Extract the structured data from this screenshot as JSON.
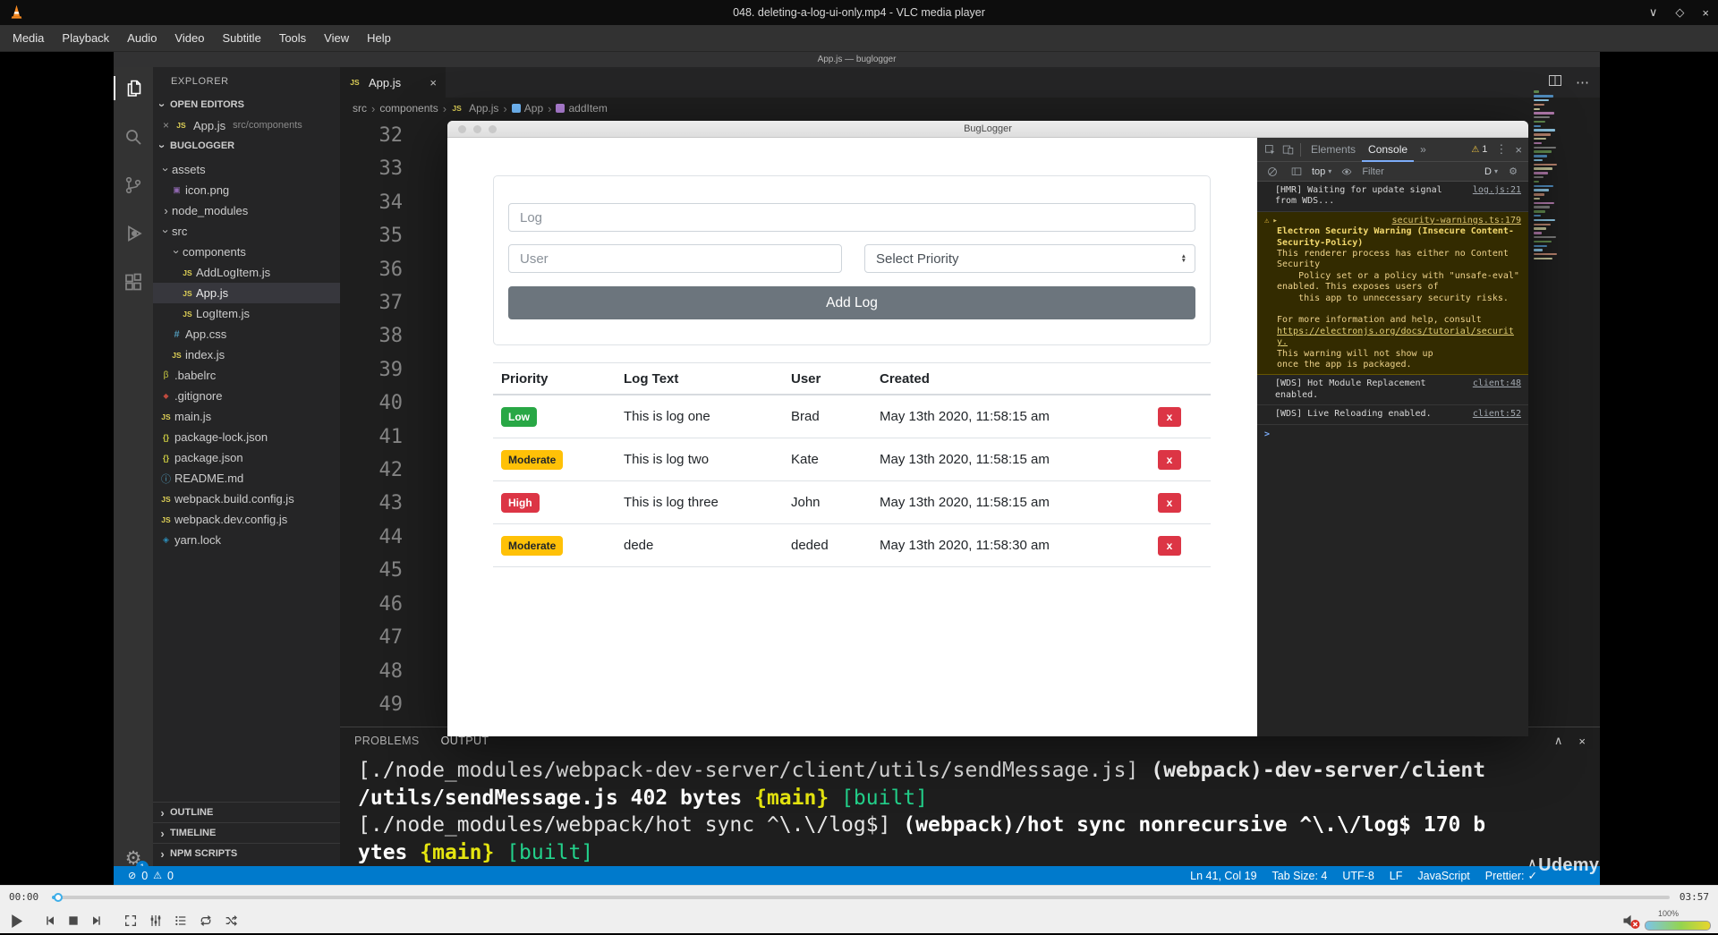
{
  "vlc": {
    "window_title": "048. deleting-a-log-ui-only.mp4 - VLC media player",
    "menu_items": [
      "Media",
      "Playback",
      "Audio",
      "Video",
      "Subtitle",
      "Tools",
      "View",
      "Help"
    ],
    "seek": {
      "elapsed": "00:00",
      "duration": "03:57"
    },
    "volume_label": "100%"
  },
  "vscode": {
    "window_title": "App.js — buglogger",
    "activity_bar": {
      "settings_badge": "1"
    },
    "explorer": {
      "title": "EXPLORER",
      "sections": {
        "open_editors": "OPEN EDITORS",
        "project": "BUGLOGGER"
      },
      "open_editor": {
        "file": "App.js",
        "path": "src/components"
      },
      "tree": [
        {
          "label": "assets",
          "icon": "folder",
          "chevron": "down",
          "level": 0
        },
        {
          "label": "icon.png",
          "icon": "image",
          "chevron": "none",
          "level": 1
        },
        {
          "label": "node_modules",
          "icon": "folder",
          "chevron": "right",
          "level": 0
        },
        {
          "label": "src",
          "icon": "folder",
          "chevron": "down",
          "level": 0
        },
        {
          "label": "components",
          "icon": "folder",
          "chevron": "down",
          "level": 1
        },
        {
          "label": "AddLogItem.js",
          "icon": "js",
          "chevron": "none",
          "level": 2
        },
        {
          "label": "App.js",
          "icon": "js",
          "chevron": "none",
          "level": 2,
          "selected": true
        },
        {
          "label": "LogItem.js",
          "icon": "js",
          "chevron": "none",
          "level": 2
        },
        {
          "label": "App.css",
          "icon": "css",
          "chevron": "none",
          "level": 1
        },
        {
          "label": "index.js",
          "icon": "js",
          "chevron": "none",
          "level": 1
        },
        {
          "label": ".babelrc",
          "icon": "babel",
          "chevron": "none",
          "level": 0
        },
        {
          "label": ".gitignore",
          "icon": "git",
          "chevron": "none",
          "level": 0
        },
        {
          "label": "main.js",
          "icon": "js",
          "chevron": "none",
          "level": 0
        },
        {
          "label": "package-lock.json",
          "icon": "json",
          "chevron": "none",
          "level": 0
        },
        {
          "label": "package.json",
          "icon": "json",
          "chevron": "none",
          "level": 0
        },
        {
          "label": "README.md",
          "icon": "info",
          "chevron": "none",
          "level": 0
        },
        {
          "label": "webpack.build.config.js",
          "icon": "js",
          "chevron": "none",
          "level": 0
        },
        {
          "label": "webpack.dev.config.js",
          "icon": "js",
          "chevron": "none",
          "level": 0
        },
        {
          "label": "yarn.lock",
          "icon": "yarn",
          "chevron": "none",
          "level": 0
        }
      ],
      "bottom_sections": [
        "OUTLINE",
        "TIMELINE",
        "NPM SCRIPTS"
      ]
    },
    "editor": {
      "tab": "App.js",
      "breadcrumb": [
        {
          "label": "src",
          "icon": "none"
        },
        {
          "label": "components",
          "icon": "none"
        },
        {
          "label": "App.js",
          "icon": "js"
        },
        {
          "label": "App",
          "icon": "variable"
        },
        {
          "label": "addItem",
          "icon": "method"
        }
      ],
      "line_numbers": [
        "32",
        "33",
        "34",
        "35",
        "36",
        "37",
        "38",
        "39",
        "40",
        "41",
        "42",
        "43",
        "44",
        "45",
        "46",
        "47",
        "48",
        "49"
      ]
    },
    "panel": {
      "tabs": [
        "PROBLEMS",
        "OUTPUT"
      ],
      "terminal_lines": [
        [
          {
            "text": "[./node_modules/webpack-dev-server/client/utils/sendMessage.js] ",
            "style": "plain"
          },
          {
            "text": "(webpack)-dev-server/client",
            "style": "bold"
          }
        ],
        [
          {
            "text": "/utils/sendMessage.js 402 bytes ",
            "style": "bold"
          },
          {
            "text": "{main}",
            "style": "yellow"
          },
          {
            "text": " ",
            "style": "plain"
          },
          {
            "text": "[built]",
            "style": "green"
          }
        ],
        [
          {
            "text": "[./node_modules/webpack/hot sync ^\\.\\/log$] ",
            "style": "plain"
          },
          {
            "text": "(webpack)/hot sync nonrecursive ^\\.\\/log$ 170 b",
            "style": "bold"
          }
        ],
        [
          {
            "text": "ytes ",
            "style": "bold"
          },
          {
            "text": "{main}",
            "style": "yellow"
          },
          {
            "text": " ",
            "style": "plain"
          },
          {
            "text": "[built]",
            "style": "green"
          }
        ]
      ]
    },
    "status_bar": {
      "errors": "0",
      "warnings": "0",
      "cursor": "Ln 41, Col 19",
      "indent": "Tab Size: 4",
      "encoding": "UTF-8",
      "eol": "LF",
      "language": "JavaScript",
      "formatter": "Prettier:"
    }
  },
  "app": {
    "window_title": "BugLogger",
    "form": {
      "log_placeholder": "Log",
      "user_placeholder": "User",
      "priority_value": "Select Priority",
      "submit_label": "Add Log"
    },
    "table": {
      "headers": [
        "Priority",
        "Log Text",
        "User",
        "Created"
      ],
      "delete_label": "x",
      "rows": [
        {
          "priority": "Low",
          "priority_color": "#28a745",
          "priority_text_color": "#ffffff",
          "log_text": "This is log one",
          "user": "Brad",
          "created": "May 13th 2020, 11:58:15 am"
        },
        {
          "priority": "Moderate",
          "priority_color": "#ffc107",
          "priority_text_color": "#212529",
          "log_text": "This is log two",
          "user": "Kate",
          "created": "May 13th 2020, 11:58:15 am"
        },
        {
          "priority": "High",
          "priority_color": "#dc3545",
          "priority_text_color": "#ffffff",
          "log_text": "This is log three",
          "user": "John",
          "created": "May 13th 2020, 11:58:15 am"
        },
        {
          "priority": "Moderate",
          "priority_color": "#ffc107",
          "priority_text_color": "#212529",
          "log_text": "dede",
          "user": "deded",
          "created": "May 13th 2020, 11:58:30 am"
        }
      ]
    }
  },
  "devtools": {
    "tabs": [
      "Elements",
      "Console"
    ],
    "active_tab": "Console",
    "more_tabs": "»",
    "warning_count": "1",
    "context_selector": "top",
    "filter_placeholder": "Filter",
    "levels_label": "D",
    "prompt": ">",
    "messages": [
      {
        "kind": "log",
        "rows": [
          {
            "text": "[HMR] Waiting for update signal",
            "style": "",
            "source": "log.js:21"
          },
          {
            "text": "from WDS...",
            "style": ""
          }
        ]
      },
      {
        "kind": "warning",
        "source": "security-warnings.ts:179",
        "rows": [
          {
            "text": "Electron Security Warning (Insecure Content-",
            "style": "bold"
          },
          {
            "text": "Security-Policy)",
            "style": "bold"
          },
          {
            "text": "This renderer process has either no Content",
            "style": ""
          },
          {
            "text": "Security",
            "style": ""
          },
          {
            "text": "    Policy set or a policy with \"unsafe-eval\"",
            "style": ""
          },
          {
            "text": "enabled. This exposes users of",
            "style": ""
          },
          {
            "text": "    this app to unnecessary security risks.",
            "style": ""
          },
          {
            "text": "",
            "style": ""
          },
          {
            "text": "For more information and help, consult",
            "style": ""
          },
          {
            "text": "https://electronjs.org/docs/tutorial/securit",
            "style": "link"
          },
          {
            "text": "y.",
            "style": "link"
          },
          {
            "text": "This warning will not show up",
            "style": ""
          },
          {
            "text": "once the app is packaged.",
            "style": ""
          }
        ]
      },
      {
        "kind": "log",
        "rows": [
          {
            "text": "[WDS] Hot Module Replacement",
            "style": "",
            "source": "client:48"
          },
          {
            "text": "enabled.",
            "style": ""
          }
        ]
      },
      {
        "kind": "log",
        "rows": [
          {
            "text": "[WDS] Live Reloading enabled.",
            "style": "",
            "source": "client:52"
          }
        ]
      }
    ]
  },
  "watermark": "Udemy"
}
